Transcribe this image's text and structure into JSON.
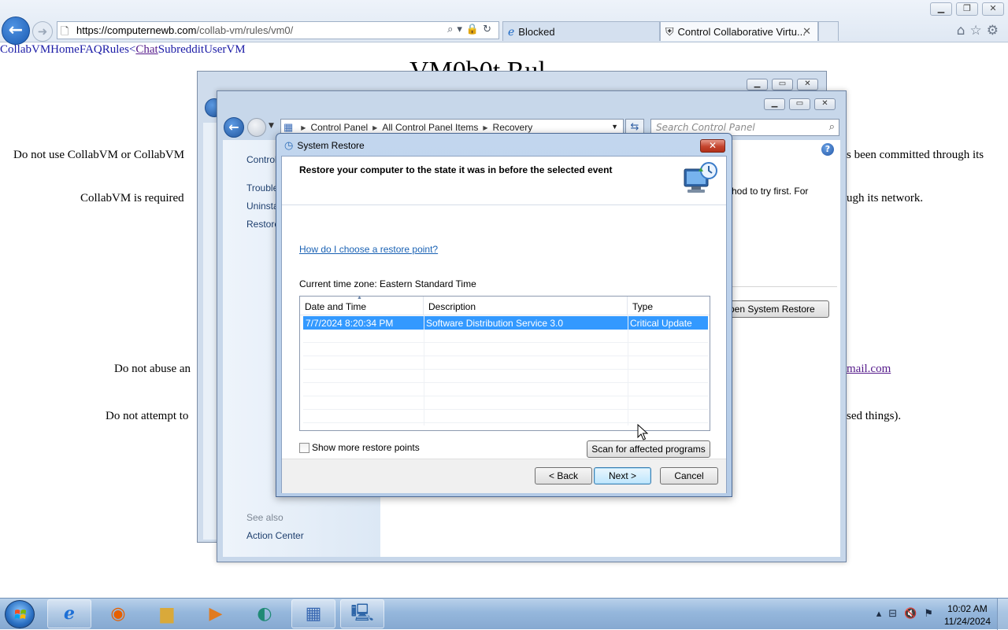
{
  "browser": {
    "url_prefix": "https://computernewb.com",
    "url_path": "/collab-vm/rules/vm0/",
    "tabs": [
      {
        "label": "Blocked",
        "active": false
      },
      {
        "label": "Control Collaborative Virtu...",
        "active": true
      }
    ],
    "window_buttons": {
      "minimize": "▁",
      "restore": "❐",
      "close": "✕"
    }
  },
  "page": {
    "nav": [
      "CollabVM",
      "Home",
      "FAQ",
      "Rules",
      "<",
      "Chat",
      "Subreddit",
      "UserVM"
    ],
    "heading": "VM0b0t Rul",
    "lines": [
      "Do not use CollabVM or CollabVM",
      "s been committed through its",
      "CollabVM is required",
      "ugh its network.",
      "Do not abuse an",
      "mail.com",
      "Do not attempt to",
      "sed things)."
    ]
  },
  "control_panel": {
    "breadcrumb": [
      "Control Panel",
      "All Control Panel Items",
      "Recovery"
    ],
    "search_placeholder": "Search Control Panel",
    "sidebar_links": [
      "Control",
      "Trouble",
      "Uninsta",
      "Restore"
    ],
    "see_also_label": "See also",
    "see_also_links": [
      "Action Center"
    ],
    "content_text": "hod to try first. For",
    "open_system_restore_label": "pen System Restore"
  },
  "system_restore": {
    "title": "System Restore",
    "heading": "Restore your computer to the state it was in before the selected event",
    "help_link": "How do I choose a restore point?",
    "timezone": "Current time zone: Eastern Standard Time",
    "columns": [
      "Date and Time",
      "Description",
      "Type"
    ],
    "rows": [
      {
        "date": "7/7/2024 8:20:34 PM",
        "description": "Software Distribution Service 3.0",
        "type": "Critical Update",
        "selected": true
      }
    ],
    "show_more_label": "Show more restore points",
    "show_more_checked": false,
    "scan_button": "Scan for affected programs",
    "back_button": "< Back",
    "next_button": "Next >",
    "cancel_button": "Cancel"
  },
  "taskbar": {
    "pinned": [
      "internet-explorer",
      "firefox",
      "file-explorer",
      "media-player",
      "browser-globe",
      "control-panel",
      "system-restore"
    ],
    "clock_time": "10:02 AM",
    "clock_date": "11/24/2024"
  },
  "colors": {
    "selection": "#3399ff",
    "link": "#1a62b4",
    "visited": "#551a8b",
    "close_red": "#c4452e"
  }
}
